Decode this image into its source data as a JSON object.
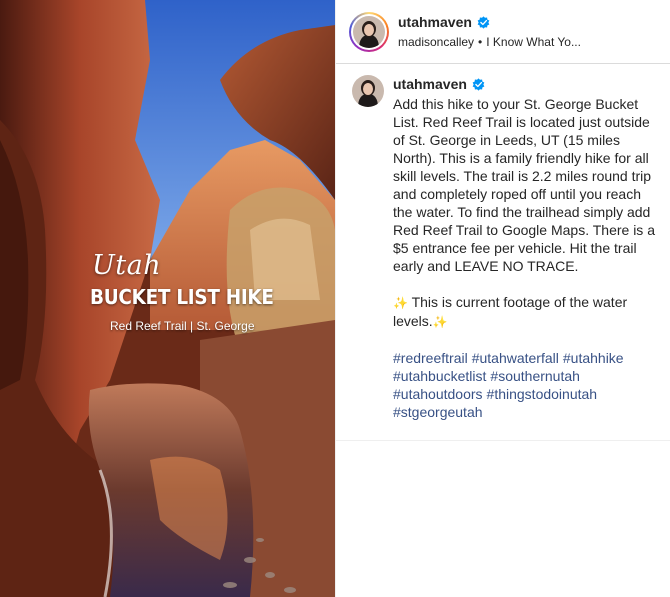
{
  "media": {
    "overlay_script": "Utah",
    "overlay_title": "BUCKET LIST HIKE",
    "overlay_subtitle": "Red Reef Trail | St. George"
  },
  "header": {
    "username": "utahmaven",
    "sub_user": "madisoncalley",
    "separator": "•",
    "audio": "I Know What Yo..."
  },
  "caption": {
    "username": "utahmaven",
    "body": "Add this hike to your St. George Bucket List. Red Reef Trail is located just outside of St. George in Leeds, UT (15 miles North). This is a family friendly hike for all skill levels. The trail is 2.2 miles round trip and completely roped off until you reach the water. To find the trailhead simply add Red Reef Trail to Google Maps. There is a $5 entrance fee per vehicle. Hit the trail early and LEAVE NO TRACE.",
    "footage_prefix": "✨",
    "footage": " This is current footage of the water levels.",
    "footage_suffix": "✨",
    "hashtags": [
      "#redreeftrail",
      "#utahwaterfall",
      "#utahhike",
      "#utahbucketlist",
      "#southernutah",
      "#utahoutdoors",
      "#thingstodoinutah",
      "#stgeorgeutah"
    ]
  },
  "colors": {
    "verified": "#0095f6",
    "hashtag": "#385185"
  },
  "icons": {
    "verified": "verified-badge-icon"
  }
}
